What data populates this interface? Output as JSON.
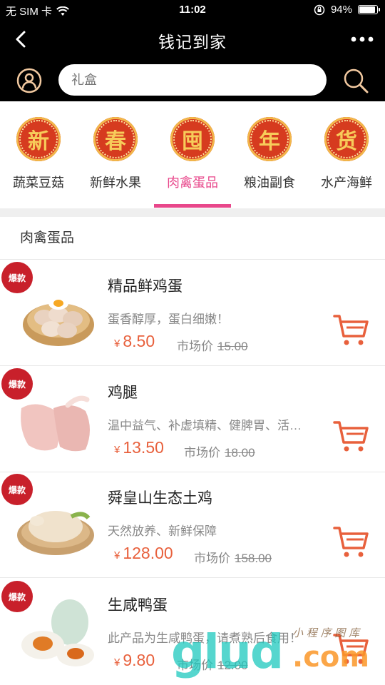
{
  "status_bar": {
    "carrier": "无 SIM 卡",
    "time": "11:02",
    "battery": "94%",
    "battery_level": 0.94
  },
  "nav": {
    "title": "钱记到家",
    "back_icon": "chevron-left-icon",
    "more_icon": "more-dots-icon"
  },
  "search": {
    "placeholder": "礼盒",
    "user_icon": "user-icon",
    "search_icon": "search-icon"
  },
  "categories": [
    {
      "char": "新",
      "label": "蔬菜豆菇",
      "active": false
    },
    {
      "char": "春",
      "label": "新鲜水果",
      "active": false
    },
    {
      "char": "囤",
      "label": "肉禽蛋品",
      "active": true
    },
    {
      "char": "年",
      "label": "粮油副食",
      "active": false
    },
    {
      "char": "货",
      "label": "水产海鲜",
      "active": false
    }
  ],
  "section_title": "肉禽蛋品",
  "currency": "¥",
  "market_label": "市场价",
  "products": [
    {
      "badge": "爆款",
      "name": "精品鲜鸡蛋",
      "desc": "蛋香醇厚，蛋白细嫩！",
      "price": "8.50",
      "market_price": "15.00"
    },
    {
      "badge": "爆款",
      "name": "鸡腿",
      "desc": "温中益气、补虚填精、健脾胃、活…",
      "price": "13.50",
      "market_price": "18.00"
    },
    {
      "badge": "爆款",
      "name": "舜皇山生态土鸡",
      "desc": "天然放养、新鲜保障",
      "price": "128.00",
      "market_price": "158.00"
    },
    {
      "badge": "爆款",
      "name": "生咸鸭蛋",
      "desc": "此产品为生咸鸭蛋，请煮熟后食用！",
      "price": "9.80",
      "market_price": "12.00"
    }
  ],
  "watermark": {
    "text": "glud",
    "suffix": ".com",
    "script": "小 程 序 图 库"
  },
  "colors": {
    "accent_pink": "#e8478b",
    "price_orange": "#e8603c",
    "header_black": "#000000"
  }
}
